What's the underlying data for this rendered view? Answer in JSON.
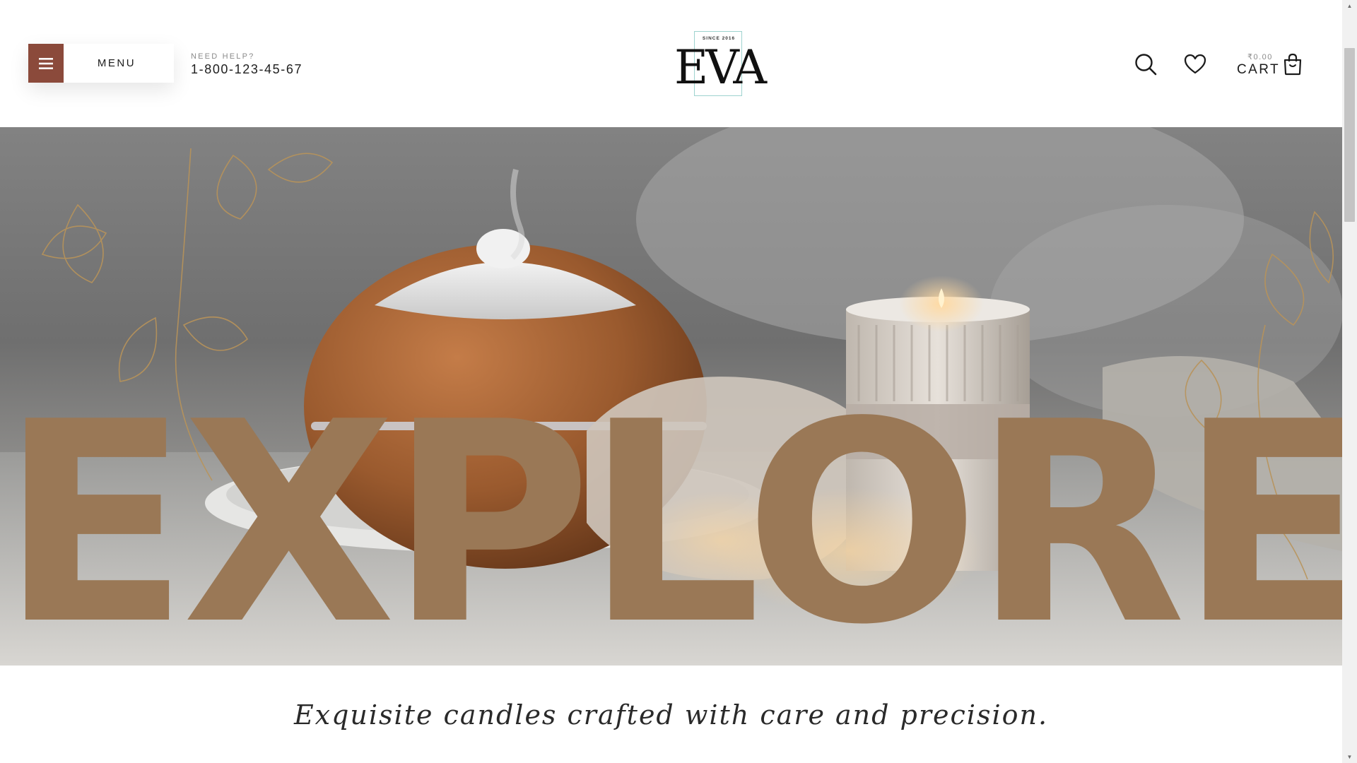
{
  "header": {
    "menu_label": "MENU",
    "help_label": "NEED HELP?",
    "help_phone": "1-800-123-45-67",
    "logo": {
      "since": "SINCE 2016",
      "word": "EVA"
    },
    "cart_amount": "₹0.00",
    "cart_label": "CART",
    "icons": [
      "menu-icon",
      "search-icon",
      "heart-icon",
      "shopping-bag-icon"
    ]
  },
  "hero": {
    "title": "EXPLORE",
    "title_color": "#9a7856"
  },
  "tagline": "Exquisite candles crafted with care and precision.",
  "colors": {
    "accent": "#8b4a3b",
    "logo_frame": "#9ed3cf",
    "text": "#1b1b1b"
  }
}
